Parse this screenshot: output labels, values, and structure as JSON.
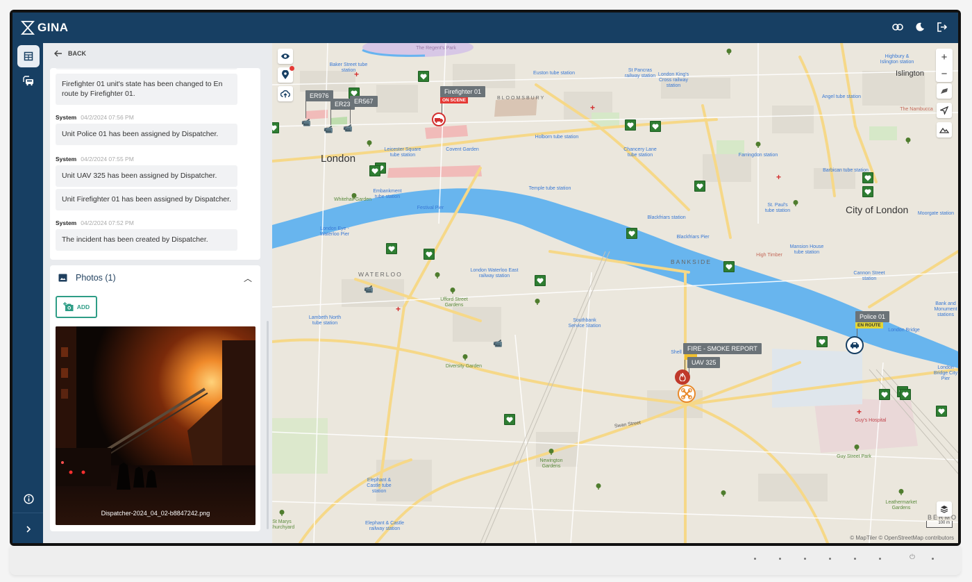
{
  "app": {
    "name": "GINA"
  },
  "topbar": {
    "icons": [
      "link-icon",
      "dark-mode-icon",
      "logout-icon"
    ]
  },
  "rail": {
    "items": [
      {
        "icon": "table-icon",
        "active": true
      },
      {
        "icon": "vehicles-icon",
        "active": false
      }
    ],
    "bottom": [
      "info-icon",
      "expand-icon"
    ]
  },
  "panel": {
    "back_label": "BACK",
    "log": [
      {
        "type": "message",
        "text": "Firefighter 01 unit's state has been changed to En route by Firefighter 01."
      },
      {
        "type": "meta",
        "author": "System",
        "time": "04/2/2024 07:56 PM"
      },
      {
        "type": "message",
        "text": "Unit Police 01 has been assigned by Dispatcher."
      },
      {
        "type": "meta",
        "author": "System",
        "time": "04/2/2024 07:55 PM"
      },
      {
        "type": "message",
        "text": "Unit UAV 325 has been assigned by Dispatcher."
      },
      {
        "type": "message",
        "text": "Unit Firefighter 01 has been assigned by Dispatcher."
      },
      {
        "type": "meta",
        "author": "System",
        "time": "04/2/2024 07:52 PM"
      },
      {
        "type": "message",
        "text": "The incident has been created by Dispatcher."
      }
    ],
    "photos": {
      "title": "Photos (1)",
      "add_label": "ADD",
      "items": [
        {
          "filename": "Dispatcher-2024_04_02-b8847242.png"
        }
      ]
    }
  },
  "map": {
    "controls": {
      "zoom_in": "+",
      "zoom_out": "−"
    },
    "places": {
      "london": "London",
      "city_of_london": "City of London",
      "islington": "Islington",
      "waterloo": "WATERLOO",
      "bankside": "BANKSIDE",
      "bloomsbury": "BLOOMSBURY",
      "regents_park": "The Regent's Park",
      "baker_street": "Baker Street tube station",
      "euston": "Euston tube station",
      "st_pancras": "St Pancras railway station",
      "kings_cross": "London King's Cross railway station",
      "angel": "Angel tube station",
      "highbury": "Highbury & Islington station",
      "holborn": "Holborn tube station",
      "chancery_lane": "Chancery Lane tube station",
      "farringdon": "Farringdon station",
      "barbican": "Barbican tube station",
      "leicester_square": "Leicester Square tube station",
      "covent_garden": "Covent Garden",
      "embankment": "Embankment tube station",
      "temple": "Temple tube station",
      "whitehall": "Whitehall Garden",
      "festival_pier": "Festival Pier",
      "london_eye_pier": "London Eye - Waterloo Pier",
      "blackfriars": "Blackfriars station",
      "blackfriars_pier": "Blackfriars Pier",
      "st_pauls": "St. Paul's tube station",
      "mansion_house": "Mansion House tube station",
      "high_timber": "High Timber",
      "moorgate": "Moorgate station",
      "cannon_street": "Cannon Street station",
      "bank": "Bank and Monument stations",
      "london_bridge": "London Bridge",
      "london_bridge_pier": "London Bridge City Pier",
      "waterloo_east": "London Waterloo East railway station",
      "ufford": "Ufford Street Gardens",
      "lambeth_north": "Lambeth North tube station",
      "southbank_station": "Southbank Service Station",
      "shell": "Shell",
      "diversity_garden": "Diversity Garden",
      "swan_street": "Swan Street",
      "newington": "Newington Gardens",
      "elephant_tube": "Elephant & Castle tube station",
      "elephant_rail": "Elephant & Castle railway station",
      "st_marys": "St Marys Churchyard",
      "guys_hospital": "Guy's Hospital",
      "guy_street_park": "Guy Street Park",
      "leathermarket": "Leathermarket Gardens",
      "bermondsey": "BERMO",
      "nambucca": "The Nambucca"
    },
    "units": [
      {
        "id": "er976",
        "label": "ER976"
      },
      {
        "id": "er23",
        "label": "ER23"
      },
      {
        "id": "er567",
        "label": "ER567"
      },
      {
        "id": "firefighter01",
        "label": "Firefighter 01",
        "status": "ON SCENE",
        "status_color": "#e53935"
      },
      {
        "id": "police01",
        "label": "Police 01",
        "status": "EN ROUTE",
        "status_color": "#e3d534"
      },
      {
        "id": "uav325",
        "label": "UAV 325"
      }
    ],
    "incident": {
      "label": "FIRE - SMOKE REPORT",
      "color": "#c0392b"
    },
    "scale_label": "100 m",
    "attribution": "© MapTiler © OpenStreetMap contributors"
  }
}
